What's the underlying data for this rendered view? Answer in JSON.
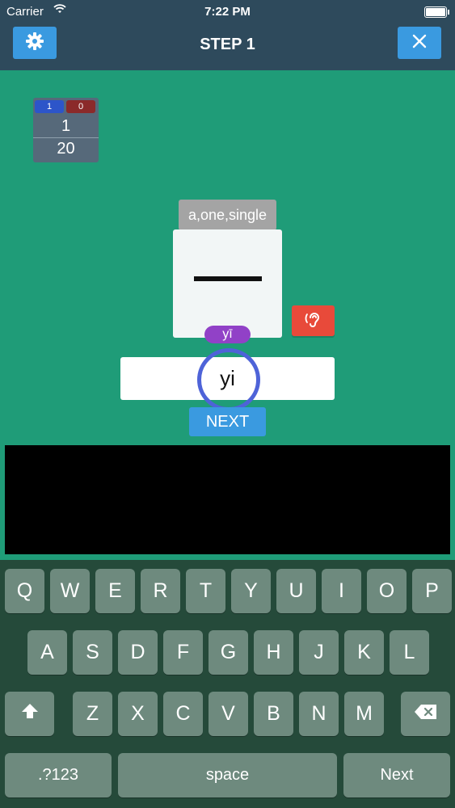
{
  "status_bar": {
    "carrier": "Carrier",
    "time": "7:22 PM"
  },
  "nav": {
    "title": "STEP 1",
    "settings_icon": "gear-icon",
    "close_icon": "close-icon"
  },
  "score": {
    "correct": "1",
    "wrong": "0",
    "current": "1",
    "total": "20"
  },
  "card": {
    "meaning": "a,one,single",
    "pinyin": "yī"
  },
  "answer": {
    "value": "yi"
  },
  "next_label": "NEXT",
  "keyboard": {
    "row1": [
      "Q",
      "W",
      "E",
      "R",
      "T",
      "Y",
      "U",
      "I",
      "O",
      "P"
    ],
    "row2": [
      "A",
      "S",
      "D",
      "F",
      "G",
      "H",
      "J",
      "K",
      "L"
    ],
    "row3": [
      "Z",
      "X",
      "C",
      "V",
      "B",
      "N",
      "M"
    ],
    "numbers": ".?123",
    "space": "space",
    "next": "Next"
  },
  "colors": {
    "accent": "#3a9ae0",
    "background": "#1f9c78",
    "nav": "#2e4a5c",
    "ear": "#e84a3a",
    "pinyin": "#9141c7"
  }
}
